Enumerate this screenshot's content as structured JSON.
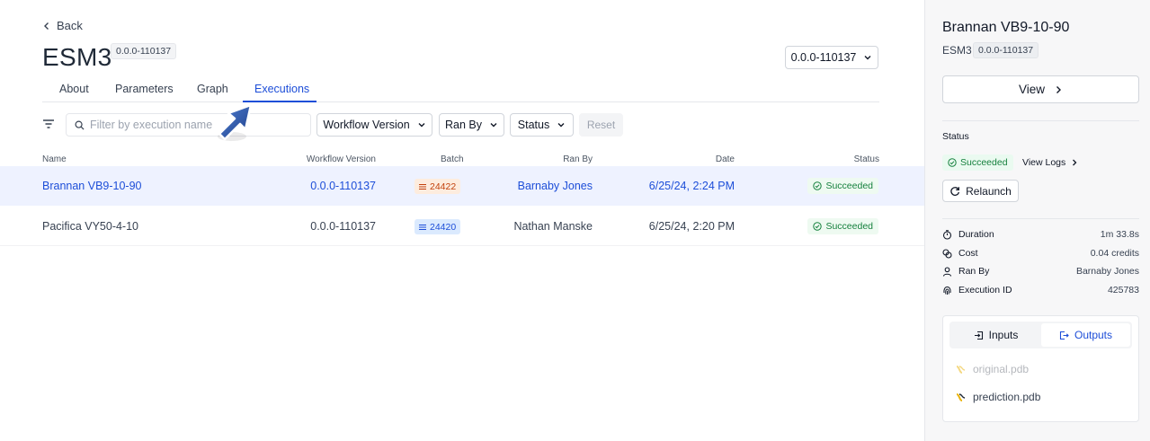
{
  "header": {
    "back_label": "Back",
    "title": "ESM3",
    "version_badge": "0.0.0-110137",
    "version_select": "0.0.0-110137"
  },
  "tabs": [
    {
      "label": "About",
      "active": false
    },
    {
      "label": "Parameters",
      "active": false
    },
    {
      "label": "Graph",
      "active": false
    },
    {
      "label": "Executions",
      "active": true
    }
  ],
  "filters": {
    "search_placeholder": "Filter by execution name",
    "workflow_version": "Workflow Version",
    "ran_by": "Ran By",
    "status": "Status",
    "reset": "Reset"
  },
  "table": {
    "columns": [
      "Name",
      "Workflow Version",
      "Batch",
      "Ran By",
      "Date",
      "Status"
    ],
    "rows": [
      {
        "name": "Brannan VB9-10-90",
        "version": "0.0.0-110137",
        "batch": "24422",
        "ran_by": "Barnaby Jones",
        "date": "6/25/24, 2:24 PM",
        "status": "Succeeded",
        "selected": true
      },
      {
        "name": "Pacifica VY50-4-10",
        "version": "0.0.0-110137",
        "batch": "24420",
        "ran_by": "Nathan Manske",
        "date": "6/25/24, 2:20 PM",
        "status": "Succeeded",
        "selected": false
      }
    ]
  },
  "side": {
    "title": "Brannan VB9-10-90",
    "workflow": "ESM3",
    "version_badge": "0.0.0-110137",
    "view_label": "View",
    "status_label": "Status",
    "status_value": "Succeeded",
    "view_logs": "View Logs",
    "relaunch": "Relaunch",
    "meta": [
      {
        "key": "Duration",
        "value": "1m 33.8s",
        "icon": "timer-icon"
      },
      {
        "key": "Cost",
        "value": "0.04 credits",
        "icon": "coins-icon"
      },
      {
        "key": "Ran By",
        "value": "Barnaby Jones",
        "icon": "user-icon"
      },
      {
        "key": "Execution ID",
        "value": "425783",
        "icon": "fingerprint-icon"
      }
    ],
    "io_tabs": {
      "inputs": "Inputs",
      "outputs": "Outputs",
      "active": "outputs"
    },
    "files": [
      "original.pdb",
      "prediction.pdb"
    ]
  },
  "colors": {
    "accent": "#1d4ed8",
    "success": "#15803d",
    "selected_row": "#eef2ff",
    "batch_orange": "#c2410c"
  }
}
